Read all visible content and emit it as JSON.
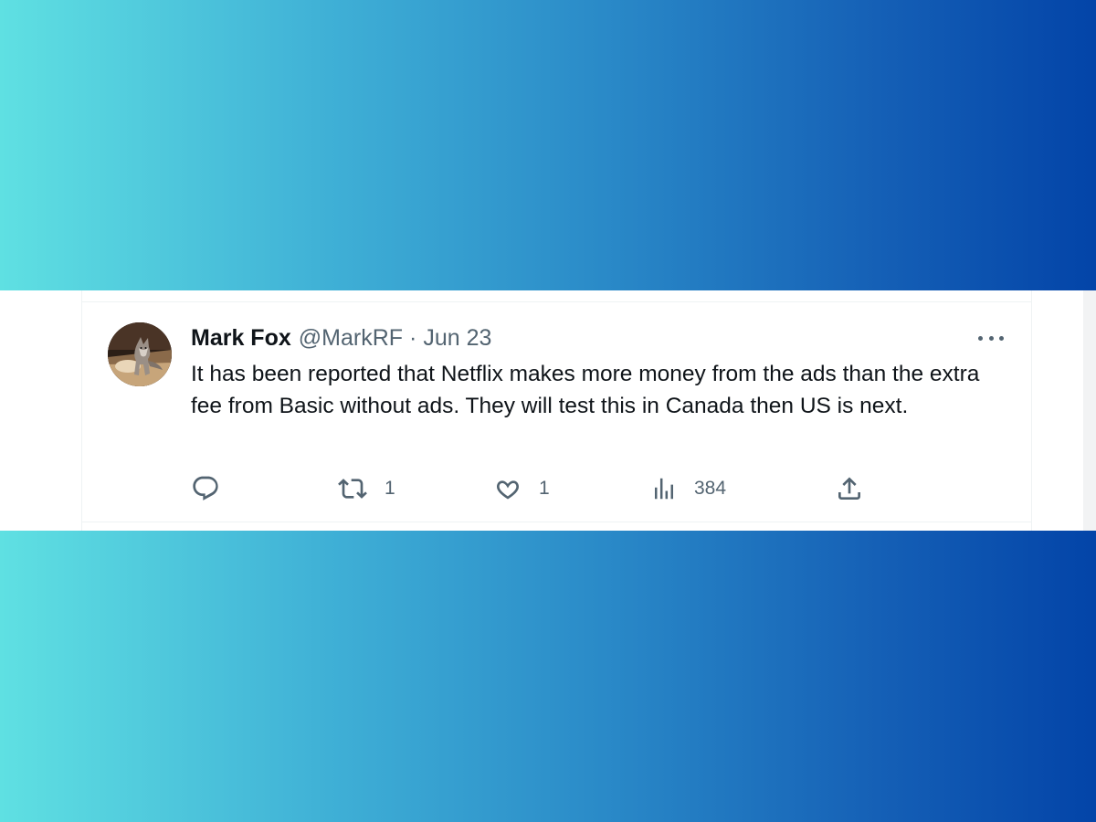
{
  "tweet": {
    "display_name": "Mark Fox",
    "handle": "@MarkRF",
    "separator": "·",
    "date": "Jun 23",
    "text": "It has been reported that Netflix makes more money from the ads than the extra fee from Basic without ads. They will test this in Canada then US is next.",
    "avatar_icon": "fox-photo-avatar",
    "more_icon": "more-dots-icon"
  },
  "actions": {
    "reply": {
      "icon": "reply-icon",
      "count": ""
    },
    "retweet": {
      "icon": "retweet-icon",
      "count": "1"
    },
    "like": {
      "icon": "heart-icon",
      "count": "1"
    },
    "views": {
      "icon": "views-bar-chart-icon",
      "count": "384"
    },
    "share": {
      "icon": "share-upload-icon"
    }
  },
  "colors": {
    "gradient_left": "#5fe0e2",
    "gradient_right": "#0344a8",
    "text_primary": "#0f1419",
    "text_secondary": "#536471"
  }
}
